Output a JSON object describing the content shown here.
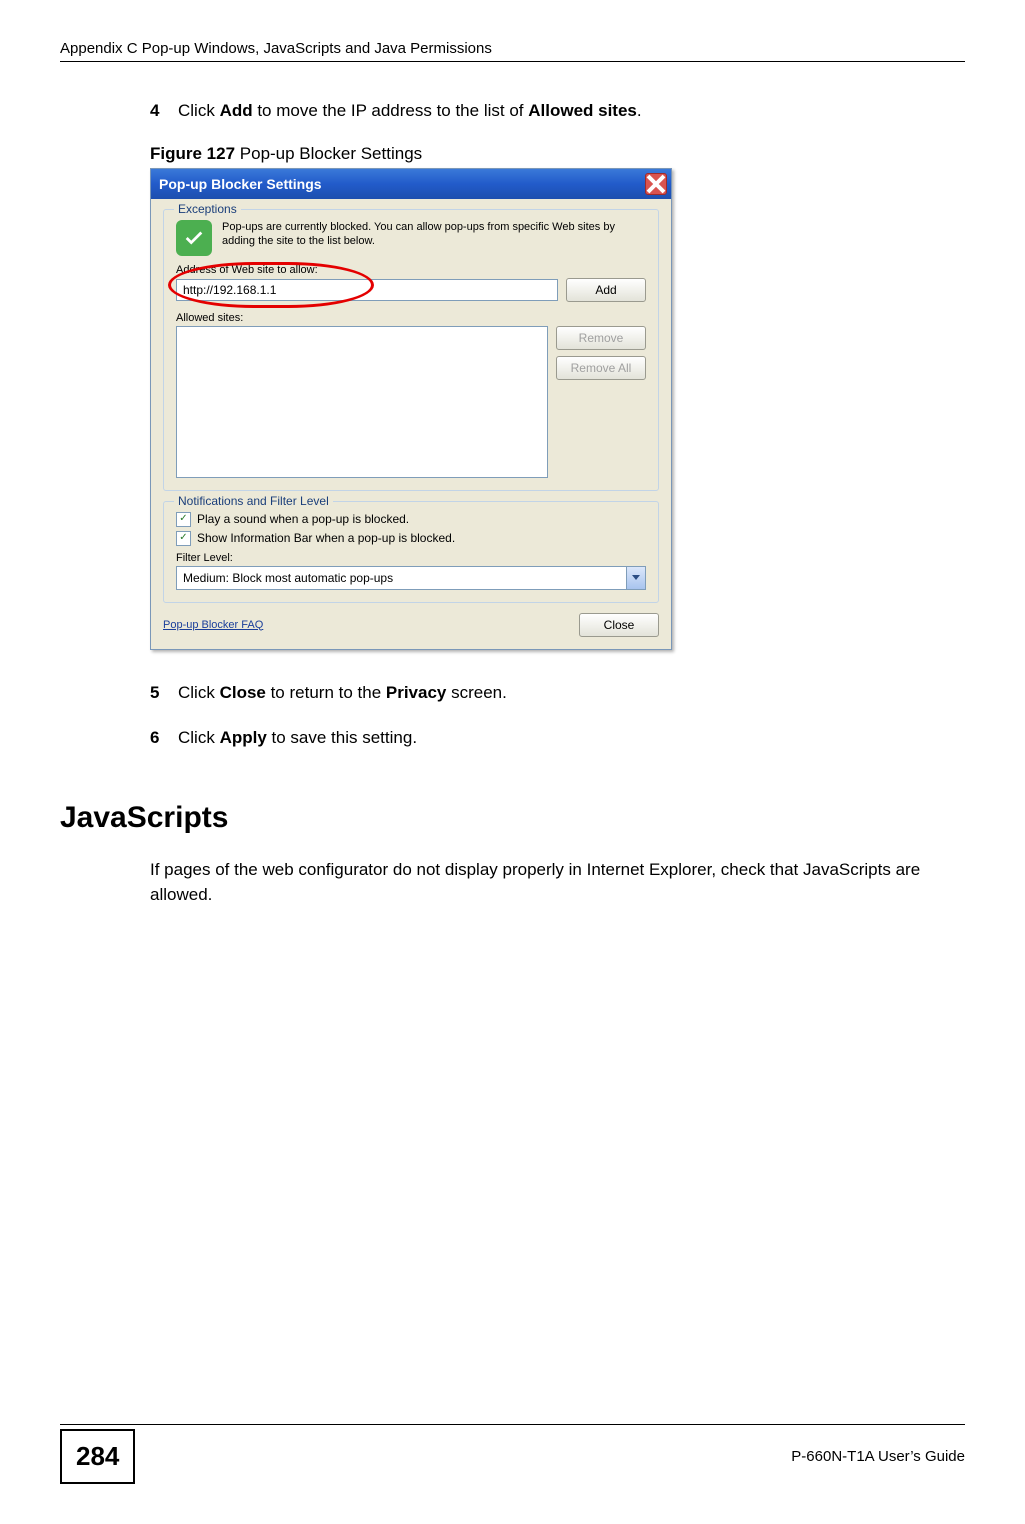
{
  "header": {
    "appendix_title": "Appendix C Pop-up Windows, JavaScripts and Java Permissions"
  },
  "steps": {
    "s4_num": "4",
    "s4_pre": "Click ",
    "s4_b1": "Add",
    "s4_mid": " to move the IP address to the list of ",
    "s4_b2": "Allowed sites",
    "s4_end": ".",
    "s5_num": "5",
    "s5_pre": "Click ",
    "s5_b1": "Close",
    "s5_mid": " to return to the ",
    "s5_b2": "Privacy",
    "s5_end": " screen.",
    "s6_num": "6",
    "s6_pre": "Click ",
    "s6_b1": "Apply",
    "s6_end": " to save this setting."
  },
  "figure": {
    "num": "Figure 127",
    "caption": "   Pop-up Blocker Settings"
  },
  "dialog": {
    "title": "Pop-up Blocker Settings",
    "exceptions_legend": "Exceptions",
    "exceptions_desc": "Pop-ups are currently blocked. You can allow pop-ups from specific Web sites by adding the site to the list below.",
    "address_label": "Address of Web site to allow:",
    "address_value": "http://192.168.1.1",
    "add_btn": "Add",
    "allowed_label": "Allowed sites:",
    "remove_btn": "Remove",
    "remove_all_btn": "Remove All",
    "notif_legend": "Notifications and Filter Level",
    "play_sound": "Play a sound when a pop-up is blocked.",
    "show_bar": "Show Information Bar when a pop-up is blocked.",
    "filter_label": "Filter Level:",
    "filter_value": "Medium: Block most automatic pop-ups",
    "faq": "Pop-up Blocker FAQ",
    "close_btn": "Close"
  },
  "section": {
    "javascripts_heading": "JavaScripts",
    "javascripts_para": "If pages of the web configurator do not display properly in Internet Explorer, check that JavaScripts are allowed."
  },
  "footer": {
    "page_num": "284",
    "guide": "P-660N-T1A User’s Guide"
  }
}
